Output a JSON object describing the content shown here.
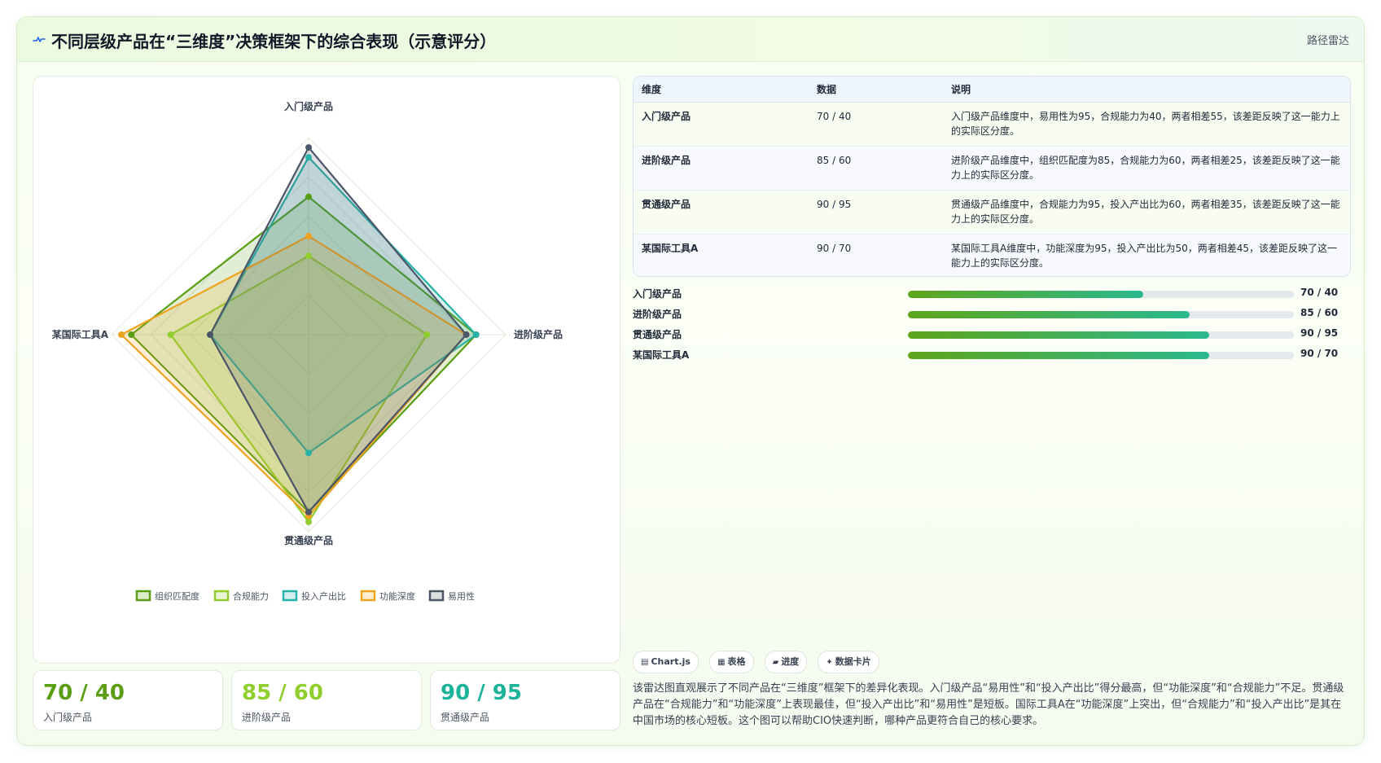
{
  "header": {
    "title": "不同层级产品在“三维度”决策框架下的综合表现（示意评分）",
    "tag": "路径雷达"
  },
  "chart_data": {
    "type": "radar",
    "axes": [
      "入门级产品",
      "进阶级产品",
      "贯通级产品",
      "某国际工具A"
    ],
    "range": [
      0,
      100
    ],
    "grid": true,
    "legend_position": "bottom",
    "series": [
      {
        "name": "组织匹配度",
        "color": "#5a9e14",
        "values": [
          70,
          85,
          90,
          90
        ]
      },
      {
        "name": "合规能力",
        "color": "#8fce2c",
        "values": [
          40,
          60,
          95,
          70
        ]
      },
      {
        "name": "投入产出比",
        "color": "#26b3a8",
        "values": [
          90,
          85,
          60,
          50
        ]
      },
      {
        "name": "功能深度",
        "color": "#eea31f",
        "values": [
          50,
          80,
          92,
          95
        ]
      },
      {
        "name": "易用性",
        "color": "#4a5568",
        "values": [
          95,
          80,
          90,
          50
        ]
      }
    ]
  },
  "kpis": [
    {
      "value": "70 / 40",
      "label": "入门级产品",
      "color": "#5a9e14"
    },
    {
      "value": "85 / 60",
      "label": "进阶级产品",
      "color": "#8fce2c"
    },
    {
      "value": "90 / 95",
      "label": "贯通级产品",
      "color": "#1db39b"
    }
  ],
  "table": {
    "headers": [
      "维度",
      "数据",
      "说明"
    ],
    "rows": [
      {
        "name": "入门级产品",
        "data": "70 / 40",
        "desc": "入门级产品维度中，易用性为95，合规能力为40，两者相差55，该差距反映了这一能力上的实际区分度。"
      },
      {
        "name": "进阶级产品",
        "data": "85 / 60",
        "desc": "进阶级产品维度中，组织匹配度为85，合规能力为60，两者相差25，该差距反映了这一能力上的实际区分度。"
      },
      {
        "name": "贯通级产品",
        "data": "90 / 95",
        "desc": "贯通级产品维度中，合规能力为95，投入产出比为60，两者相差35，该差距反映了这一能力上的实际区分度。"
      },
      {
        "name": "某国际工具A",
        "data": "90 / 70",
        "desc": "某国际工具A维度中，功能深度为95，投入产出比为50，两者相差45，该差距反映了这一能力上的实际区分度。"
      }
    ]
  },
  "progress": [
    {
      "label": "入门级产品",
      "value": "70 / 40",
      "fill": 0.61
    },
    {
      "label": "进阶级产品",
      "value": "85 / 60",
      "fill": 0.73
    },
    {
      "label": "贯通级产品",
      "value": "90 / 95",
      "fill": 0.78
    },
    {
      "label": "某国际工具A",
      "value": "90 / 70",
      "fill": 0.78
    }
  ],
  "chips": [
    {
      "icon": "chart-icon",
      "glyph": "▤",
      "label": "Chart.js"
    },
    {
      "icon": "table-icon",
      "glyph": "▦",
      "label": "表格"
    },
    {
      "icon": "progress-icon",
      "glyph": "▰",
      "label": "进度"
    },
    {
      "icon": "card-icon",
      "glyph": "✦",
      "label": "数据卡片"
    }
  ],
  "description": "该雷达图直观展示了不同产品在“三维度”框架下的差异化表现。入门级产品“易用性”和“投入产出比”得分最高，但“功能深度”和“合规能力”不足。贯通级产品在“合规能力”和“功能深度”上表现最佳，但“投入产出比”和“易用性”是短板。国际工具A在“功能深度”上突出，但“合规能力”和“投入产出比”是其在中国市场的核心短板。这个图可以帮助CIO快速判断，哪种产品更符合自己的核心要求。"
}
